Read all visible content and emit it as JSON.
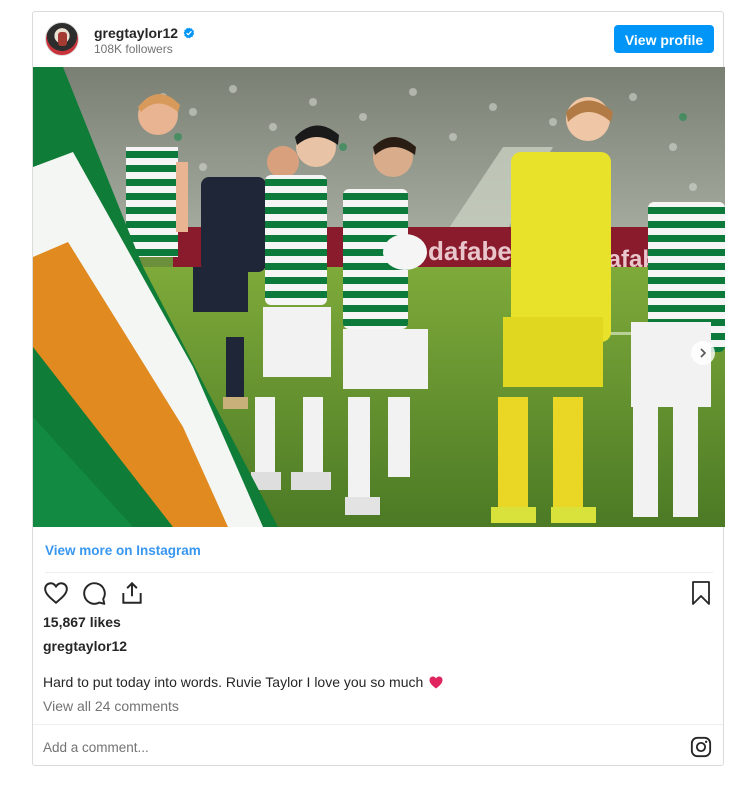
{
  "header": {
    "username": "gregtaylor12",
    "followers": "108K followers",
    "view_profile_label": "View profile",
    "verified_icon": "verified-badge-icon",
    "avatar_icon": "profile-avatar"
  },
  "photo": {
    "ad_boards": [
      "dafabet",
      "dafabet"
    ],
    "shirt_sponsor": "dafa"
  },
  "links": {
    "view_more": "View more on Instagram"
  },
  "actions": {
    "icons": [
      "heart-icon",
      "comment-icon",
      "share-icon",
      "bookmark-icon"
    ]
  },
  "post": {
    "likes": "15,867 likes",
    "owner": "gregtaylor12",
    "caption": "Hard to put today into words. Ruvie Taylor I love you so much",
    "view_comments": "View all 24 comments",
    "add_comment_placeholder": "Add a comment..."
  },
  "colors": {
    "accent": "#0095f6",
    "link": "#3897f0",
    "celtic_green": "#0b7a3b",
    "heart": "#e0245e"
  }
}
